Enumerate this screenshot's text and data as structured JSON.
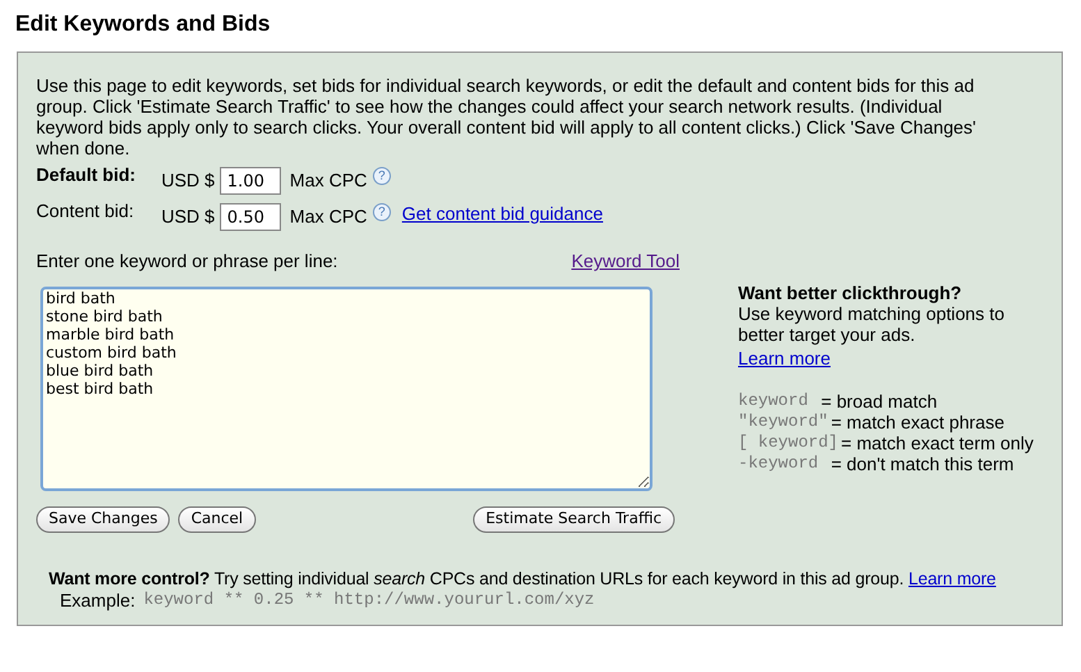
{
  "title": "Edit Keywords and Bids",
  "intro": "Use this page to edit keywords, set bids for individual search keywords, or edit the default and content bids for this ad group. Click 'Estimate Search Traffic' to see how the changes could affect your search network results. (Individual keyword bids apply only to search clicks. Your overall content bid will apply to all content clicks.) Click 'Save Changes' when done.",
  "bids": [
    {
      "label": "Default bid:",
      "bold": true,
      "currency": "USD $",
      "value": "1.00",
      "unit": "Max CPC",
      "help": "?"
    },
    {
      "label": "Content bid:",
      "bold": false,
      "currency": "USD $",
      "value": "0.50",
      "unit": "Max CPC",
      "help": "?",
      "link": "Get content bid guidance"
    }
  ],
  "keywords_label": "Enter one keyword or phrase per line:",
  "keyword_tool_link": "Keyword Tool",
  "keywords": [
    "bird bath",
    "stone bird bath",
    "marble bird bath",
    "custom bird bath",
    "blue bird bath",
    "best bird bath"
  ],
  "buttons": [
    "Save Changes",
    "Cancel"
  ],
  "estimate_button": "Estimate Search Traffic",
  "tip": {
    "heading": "Want better clickthrough?",
    "text": "Use keyword matching options to better target your ads.",
    "link": "Learn more",
    "matches": [
      {
        "syntax": "keyword ",
        "meaning": "= broad match"
      },
      {
        "syntax": "\"keyword\"",
        "meaning": "= match exact phrase"
      },
      {
        "syntax": "[ keyword]",
        "meaning": "= match exact term only"
      },
      {
        "syntax": "-keyword ",
        "meaning": "= don't match this term"
      }
    ]
  },
  "more": {
    "text": "**Want more control?** Try setting individual *search* CPCs and destination URLs for each keyword in this ad group.",
    "link": "Learn more",
    "example_label": "Example:",
    "example": "keyword ** 0.25 ** http://www.yoururl.com/xyz"
  }
}
